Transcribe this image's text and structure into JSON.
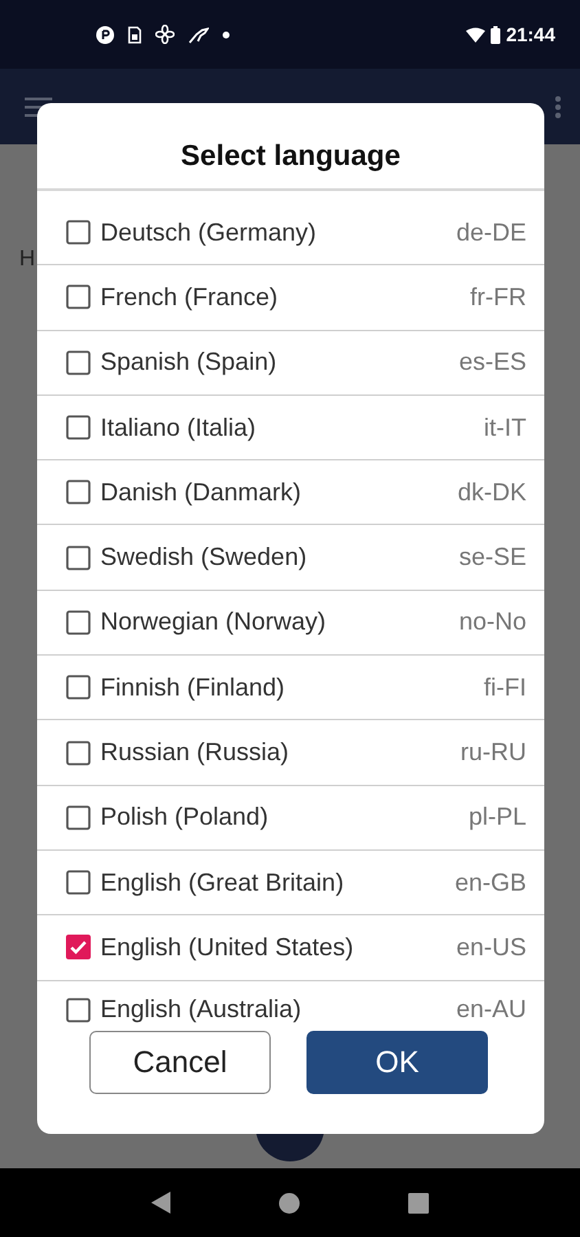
{
  "status_bar": {
    "time": "21:44"
  },
  "background": {
    "text": "H"
  },
  "dialog": {
    "title": "Select language",
    "languages": [
      {
        "name": "Deutsch (Germany)",
        "code": "de-DE",
        "checked": false
      },
      {
        "name": "French (France)",
        "code": "fr-FR",
        "checked": false
      },
      {
        "name": "Spanish (Spain)",
        "code": "es-ES",
        "checked": false
      },
      {
        "name": "Italiano (Italia)",
        "code": "it-IT",
        "checked": false
      },
      {
        "name": "Danish (Danmark)",
        "code": "dk-DK",
        "checked": false
      },
      {
        "name": "Swedish (Sweden)",
        "code": "se-SE",
        "checked": false
      },
      {
        "name": "Norwegian (Norway)",
        "code": "no-No",
        "checked": false
      },
      {
        "name": "Finnish (Finland)",
        "code": "fi-FI",
        "checked": false
      },
      {
        "name": "Russian (Russia)",
        "code": "ru-RU",
        "checked": false
      },
      {
        "name": "Polish (Poland)",
        "code": "pl-PL",
        "checked": false
      },
      {
        "name": "English (Great Britain)",
        "code": "en-GB",
        "checked": false
      },
      {
        "name": "English (United States)",
        "code": "en-US",
        "checked": true
      },
      {
        "name": "English (Australia)",
        "code": "en-AU",
        "checked": false
      }
    ],
    "buttons": [
      {
        "label": "Cancel",
        "kind": "secondary"
      },
      {
        "label": "OK",
        "kind": "primary"
      }
    ]
  }
}
